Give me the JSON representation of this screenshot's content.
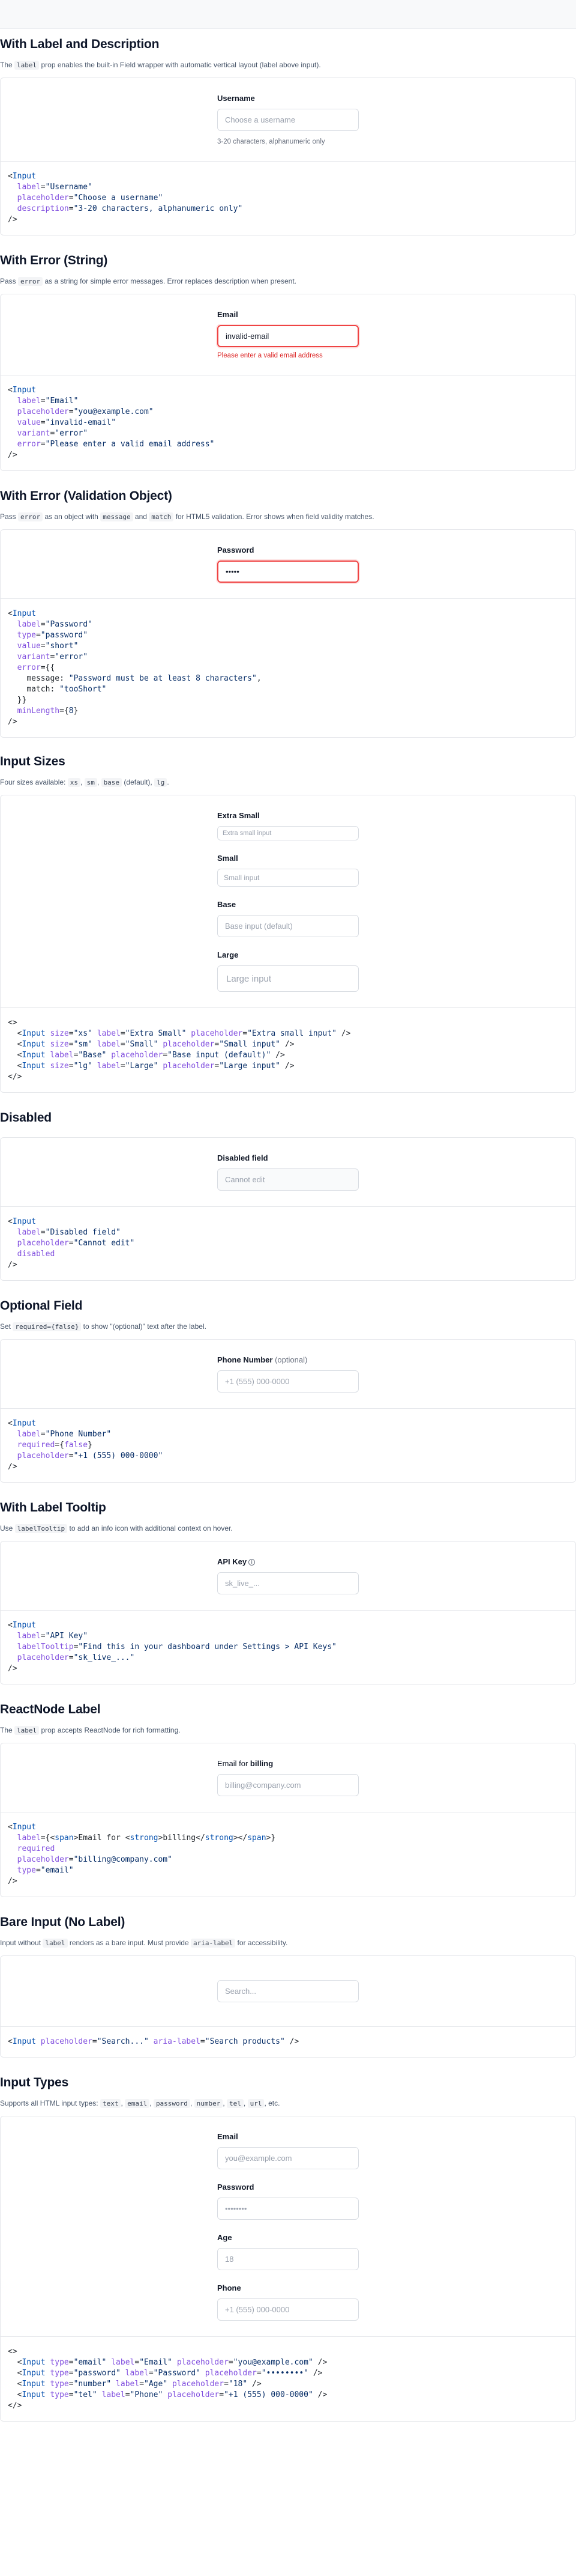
{
  "sections": {
    "label_desc": {
      "title": "With Label and Description",
      "desc_pre": "The ",
      "desc_code": "label",
      "desc_post": " prop enables the built-in Field wrapper with automatic vertical layout (label above input).",
      "label": "Username",
      "placeholder": "Choose a username",
      "description": "3-20 characters, alphanumeric only"
    },
    "error_string": {
      "title": "With Error (String)",
      "desc_pre": "Pass ",
      "desc_code": "error",
      "desc_post": " as a string for simple error messages. Error replaces description when present.",
      "label": "Email",
      "value": "invalid-email",
      "error": "Please enter a valid email address"
    },
    "error_object": {
      "title": "With Error (Validation Object)",
      "desc_pre": "Pass ",
      "desc_code": "error",
      "desc_mid1": " as an object with ",
      "desc_code2": "message",
      "desc_mid2": " and ",
      "desc_code3": "match",
      "desc_post": " for HTML5 validation. Error shows when field validity matches.",
      "label": "Password",
      "value": "•••••"
    },
    "sizes": {
      "title": "Input Sizes",
      "desc_pre": "Four sizes available: ",
      "c1": "xs",
      "c2": "sm",
      "c3": "base",
      "mid": " (default), ",
      "c4": "lg",
      "post": ".",
      "xs_label": "Extra Small",
      "xs_placeholder": "Extra small input",
      "sm_label": "Small",
      "sm_placeholder": "Small input",
      "base_label": "Base",
      "base_placeholder": "Base input (default)",
      "lg_label": "Large",
      "lg_placeholder": "Large input"
    },
    "disabled": {
      "title": "Disabled",
      "label": "Disabled field",
      "placeholder": "Cannot edit"
    },
    "optional": {
      "title": "Optional Field",
      "desc_pre": "Set ",
      "desc_code": "required={false}",
      "desc_post": " to show \"(optional)\" text after the label.",
      "label": "Phone Number",
      "optional": "(optional)",
      "placeholder": "+1 (555) 000-0000"
    },
    "tooltip": {
      "title": "With Label Tooltip",
      "desc_pre": "Use ",
      "desc_code": "labelTooltip",
      "desc_post": " to add an info icon with additional context on hover.",
      "label": "API Key",
      "icon": "i",
      "placeholder": "sk_live_..."
    },
    "reactnode": {
      "title": "ReactNode Label",
      "desc_pre": "The ",
      "desc_code": "label",
      "desc_post": " prop accepts ReactNode for rich formatting.",
      "label_pre": "Email for ",
      "label_strong": "billing",
      "placeholder": "billing@company.com"
    },
    "bare": {
      "title": "Bare Input (No Label)",
      "desc_pre": "Input without ",
      "desc_code": "label",
      "desc_mid": " renders as a bare input. Must provide ",
      "desc_code2": "aria-label",
      "desc_post": " for accessibility.",
      "placeholder": "Search..."
    },
    "types": {
      "title": "Input Types",
      "desc_pre": "Supports all HTML input types: ",
      "c1": "text",
      "c2": "email",
      "c3": "password",
      "c4": "number",
      "c5": "tel",
      "c6": "url",
      "post": ", etc.",
      "email_label": "Email",
      "email_placeholder": "you@example.com",
      "password_label": "Password",
      "password_placeholder": "••••••••",
      "age_label": "Age",
      "age_placeholder": "18",
      "phone_label": "Phone",
      "phone_placeholder": "+1 (555) 000-0000"
    }
  },
  "code": {
    "label_desc": [
      [
        "<",
        "Input"
      ],
      [
        "label",
        "\"Username\""
      ],
      [
        "placeholder",
        "\"Choose a username\""
      ],
      [
        "description",
        "\"3-20 characters, alphanumeric only\""
      ]
    ],
    "error_string": [
      [
        "label",
        "\"Email\""
      ],
      [
        "placeholder",
        "\"you@example.com\""
      ],
      [
        "value",
        "\"invalid-email\""
      ],
      [
        "variant",
        "\"error\""
      ],
      [
        "error",
        "\"Please enter a valid email address\""
      ]
    ],
    "error_object": {
      "label": "\"Password\"",
      "type": "\"password\"",
      "value": "\"short\"",
      "variant": "\"error\"",
      "message": "\"Password must be at least 8 characters\"",
      "match": "\"tooShort\"",
      "minLength": "8"
    },
    "sizes": [
      [
        "\"xs\"",
        "\"Extra Small\"",
        "\"Extra small input\""
      ],
      [
        "\"sm\"",
        "\"Small\"",
        "\"Small input\""
      ],
      [
        "",
        "\"Base\"",
        "\"Base input (default)\""
      ],
      [
        "\"lg\"",
        "\"Large\"",
        "\"Large input\""
      ]
    ],
    "disabled": {
      "label": "\"Disabled field\"",
      "placeholder": "\"Cannot edit\"",
      "flag": "disabled"
    },
    "optional": {
      "label": "\"Phone Number\"",
      "required": "false",
      "placeholder": "\"+1 (555) 000-0000\""
    },
    "tooltip": {
      "label": "\"API Key\"",
      "labelTooltip": "\"Find this in your dashboard under Settings > API Keys\"",
      "placeholder": "\"sk_live_...\""
    },
    "reactnode": {
      "label_text": "Email for ",
      "strong": "billing",
      "required": "required",
      "placeholder": "\"billing@company.com\"",
      "type": "\"email\""
    },
    "bare": {
      "placeholder": "\"Search...\"",
      "aria": "\"Search products\""
    },
    "types": [
      [
        "\"email\"",
        "\"Email\"",
        "\"you@example.com\""
      ],
      [
        "\"password\"",
        "\"Password\"",
        "\"••••••••\""
      ],
      [
        "\"number\"",
        "\"Age\"",
        "\"18\""
      ],
      [
        "\"tel\"",
        "\"Phone\"",
        "\"+1 (555) 000-0000\""
      ]
    ]
  }
}
